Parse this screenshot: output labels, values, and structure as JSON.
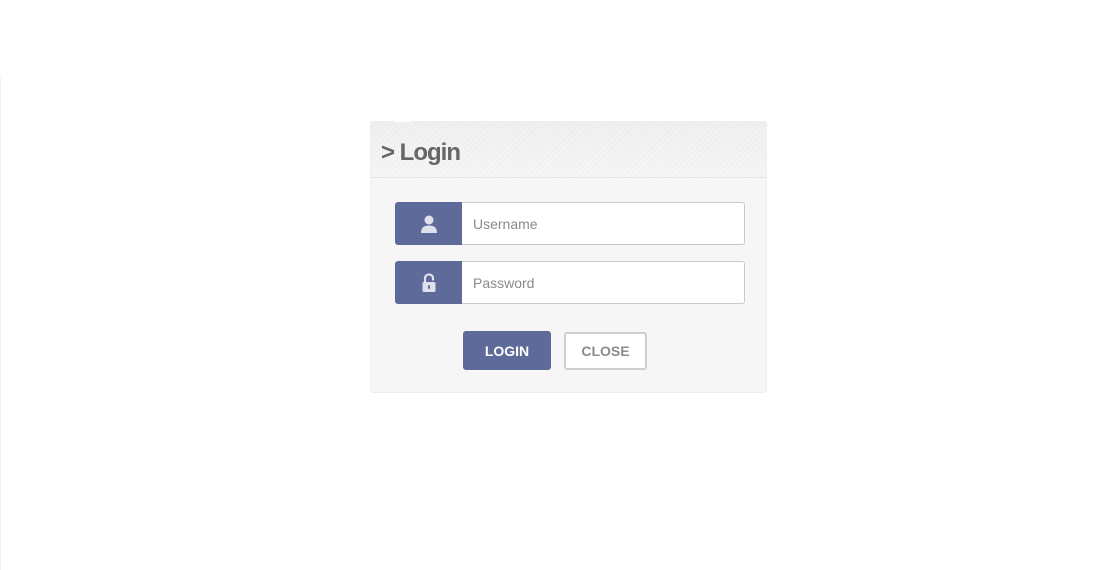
{
  "dialog": {
    "title": "> Login"
  },
  "fields": {
    "username": {
      "icon": "user-icon",
      "value": "",
      "placeholder": "Username"
    },
    "password": {
      "icon": "padlock-icon",
      "value": "",
      "placeholder": "Password"
    }
  },
  "buttons": {
    "login_label": "LOGIN",
    "close_label": "CLOSE"
  },
  "colors": {
    "accent": "#5e6a9a",
    "panel_background": "#f6f6f6",
    "title_text": "#666666"
  }
}
